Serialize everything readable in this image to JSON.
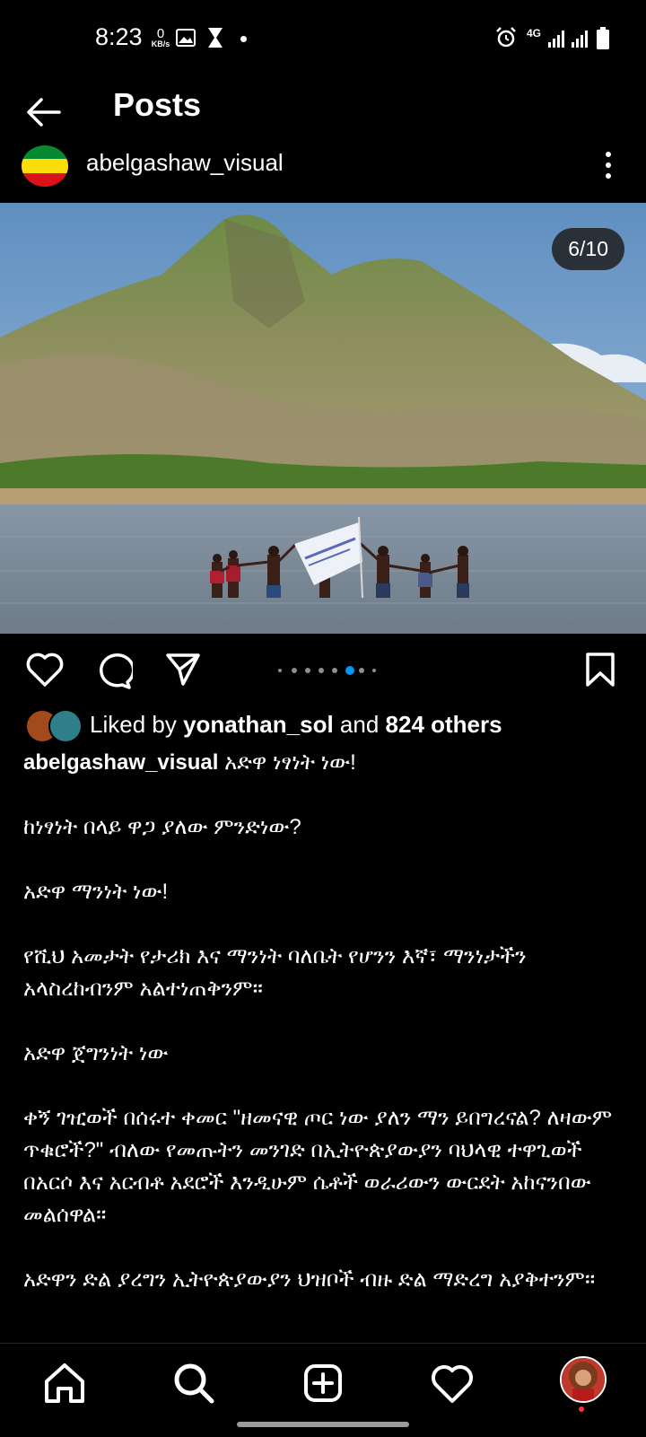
{
  "status_bar": {
    "time": "8:23",
    "data_rate_value": "0",
    "data_rate_unit": "KB/s",
    "network": "4G"
  },
  "header": {
    "title": "Posts"
  },
  "post": {
    "username": "abelgashaw_visual",
    "slide_counter": "6/10",
    "carousel": {
      "count": 8,
      "active_index": 5
    },
    "likes": {
      "prefix": "Liked by",
      "liker": "yonathan_sol",
      "conjunction": "and",
      "others": "824 others"
    },
    "caption": {
      "username": "abelgashaw_visual",
      "first_line": "አድዋ ነፃነት ነው!",
      "paragraphs": [
        "ከነፃነት በላይ ዋጋ ያለው ምንድነው?",
        "አድዋ ማንነት ነው!",
        "የሺህ አመታት የታሪክ እና ማንነት ባለቤት የሆንን እኛ፣ ማንነታችን አላስረከብንም አልተነጠቅንም።",
        "አድዋ ጀግንነት ነው",
        "ቀኝ ገዢወች በሰሩተ ቀመር \"ዘመናዊ ጦር ነው ያለን ማን ይበግረናል? ለዛውም ጥቁሮች?\" ብለው የመጡትን መንገድ በኢትዮጵያውያን ባህላዊ ተዋጊወች በአርሶ እና አርብቶ አደሮች እንዲሁም ሴቶች ወራሪውን ውርደት አከናንበው መልሰዋል።",
        "አድዋን ድል ያረግን ኢትዮጵያውያን ህዝቦች ብዙ ድል ማድረግ አያቅተንም።"
      ]
    }
  },
  "colors": {
    "background": "#000000",
    "text": "#ffffff",
    "active_dot": "#0095f6",
    "inactive_dot": "#8e8e8e",
    "notification": "#ff3040",
    "flag_green": "#078930",
    "flag_yellow": "#fcdd09",
    "flag_red": "#da121a"
  },
  "icons": {
    "back": "arrow-left-icon",
    "more": "more-vertical-icon",
    "like": "heart-icon",
    "comment": "comment-icon",
    "share": "send-icon",
    "save": "bookmark-icon",
    "nav": [
      "home-icon",
      "search-icon",
      "add-post-icon",
      "activity-heart-icon",
      "profile-avatar"
    ]
  }
}
